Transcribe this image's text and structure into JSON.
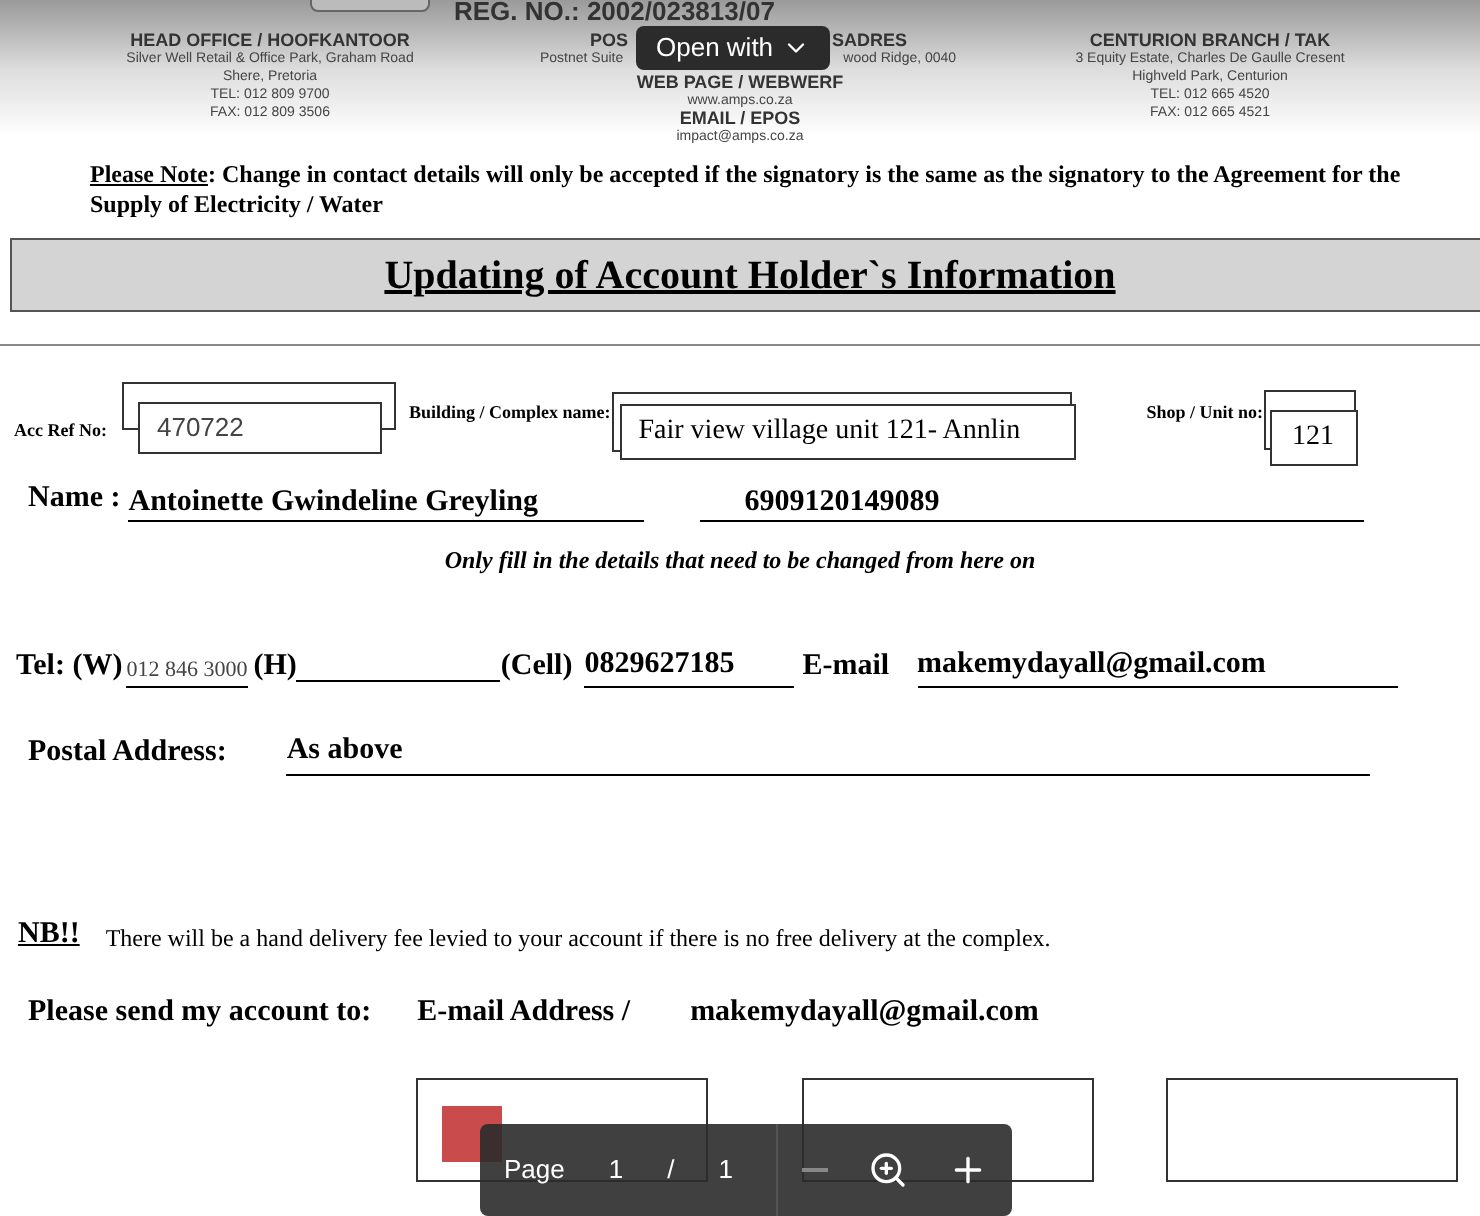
{
  "header": {
    "reg_no": "REG. NO.: 2002/023813/07",
    "columns": [
      {
        "title": "HEAD OFFICE / HOOFKANTOOR",
        "lines": [
          "Silver Well Retail & Office Park, Graham Road",
          "Shere, Pretoria",
          "TEL: 012 809 9700",
          "FAX: 012 809 3506"
        ]
      },
      {
        "title": "POS",
        "title_end": "SADRES",
        "lines": [
          "Postnet Suite",
          "wood Ridge, 0040"
        ],
        "sub": [
          {
            "title": "WEB PAGE / WEBWERF",
            "line": "www.amps.co.za"
          },
          {
            "title": "EMAIL / EPOS",
            "line": "impact@amps.co.za"
          }
        ]
      },
      {
        "title": "CENTURION BRANCH / TAK",
        "lines": [
          "3 Equity Estate, Charles De Gaulle Cresent",
          "Highveld Park, Centurion",
          "TEL: 012 665 4520",
          "FAX: 012 665 4521"
        ]
      }
    ]
  },
  "open_with_button": "Open with",
  "note": {
    "label": "Please Note",
    "text": ": Change in contact details will only be accepted if the signatory is the same as the signatory to the Agreement for the Supply of Electricity / Water"
  },
  "title": "Updating of Account Holder`s Information",
  "form": {
    "acc_ref_label": "Acc Ref No:",
    "acc_ref": "470722",
    "building_label": "Building / Complex name:",
    "building": "Fair view village unit 121- Annlin",
    "unit_label": "Shop / Unit no:",
    "unit": "121",
    "name_label": "Name :",
    "name": "Antoinette Gwindeline Greyling",
    "id_number": "6909120149089",
    "instruction": "Only fill in the details that need to be changed from here on",
    "tel_w_label": "Tel: (W)",
    "tel_w": "012 846 3000",
    "tel_h_label": "(H)",
    "cell_label": "(Cell)",
    "cell": "0829627185",
    "email_label": "E-mail",
    "email": "makemydayall@gmail.com",
    "postal_label": "Postal Address:",
    "postal": "As above",
    "nb_label": "NB!!",
    "nb_text": "There will be a hand delivery fee levied to your account if there is no free delivery at the complex.",
    "send_label": "Please send my account to:",
    "send_method": "E-mail Address /",
    "send_email": "makemydayall@gmail.com"
  },
  "viewer_toolbar": {
    "page_label": "Page",
    "page": "1",
    "separator": "/",
    "total": "1"
  }
}
